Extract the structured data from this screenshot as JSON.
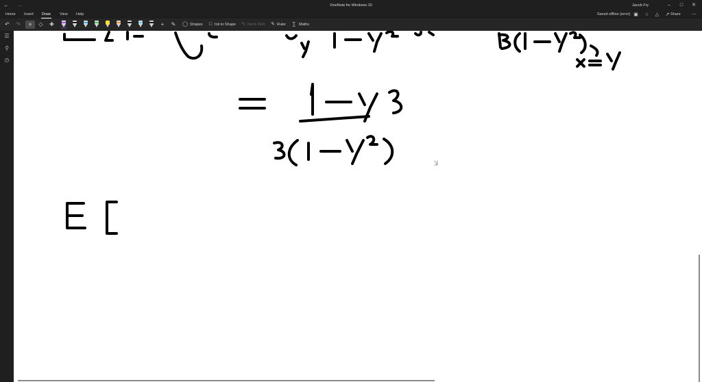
{
  "window": {
    "title": "OneNote for Windows 10",
    "user": "Jacob Fry",
    "nav_back_icon": "back-arrow-icon",
    "nav_forward_icon": "forward-arrow-icon",
    "controls": [
      "minimize-icon",
      "restore-icon",
      "close-icon"
    ]
  },
  "ribbon": {
    "tabs": [
      {
        "label": "Home",
        "active": false
      },
      {
        "label": "Insert",
        "active": false
      },
      {
        "label": "Draw",
        "active": true
      },
      {
        "label": "View",
        "active": false
      },
      {
        "label": "Help",
        "active": false
      }
    ],
    "status": "Saved offline (error)",
    "share_label": "Share",
    "right_icons": [
      "notebook-icon",
      "lightbulb-icon",
      "bell-icon",
      "share-icon",
      "more-icon"
    ]
  },
  "toolbar": {
    "undo_icon": "undo-icon",
    "redo_icon": "redo-icon",
    "select_icon": "lasso-select-icon",
    "eraser_icon": "eraser-icon",
    "add_space_icon": "add-space-icon",
    "pens": [
      {
        "name": "pen-black",
        "color": "#111111"
      },
      {
        "name": "pen-purple",
        "color": "#9b59d0"
      },
      {
        "name": "pen-black-2",
        "color": "#111111"
      },
      {
        "name": "pen-blue",
        "color": "#4aa3e0"
      },
      {
        "name": "pen-green",
        "color": "#4fc04f"
      },
      {
        "name": "highlighter-yellow",
        "color": "#f4e23a"
      },
      {
        "name": "pen-orange",
        "color": "#e8912d"
      },
      {
        "name": "pen-black-3",
        "color": "#111111"
      },
      {
        "name": "pen-lightblue",
        "color": "#6cc3e8"
      },
      {
        "name": "pen-black-4",
        "color": "#111111"
      }
    ],
    "add_pen_icon": "plus-icon",
    "ink_replay_icon": "ink-to-text-icon",
    "shapes_label": "Shapes",
    "ink_to_shape_label": "Ink to Shape",
    "ink_to_text_label": "Ink to Text",
    "ruler_label": "Ruler",
    "maths_label": "Maths"
  },
  "leftrail": {
    "icons": [
      "notebooks-icon",
      "search-icon",
      "recent-icon"
    ]
  },
  "accent_color": "#ffffff",
  "chrome_color": "#1f1f1f"
}
